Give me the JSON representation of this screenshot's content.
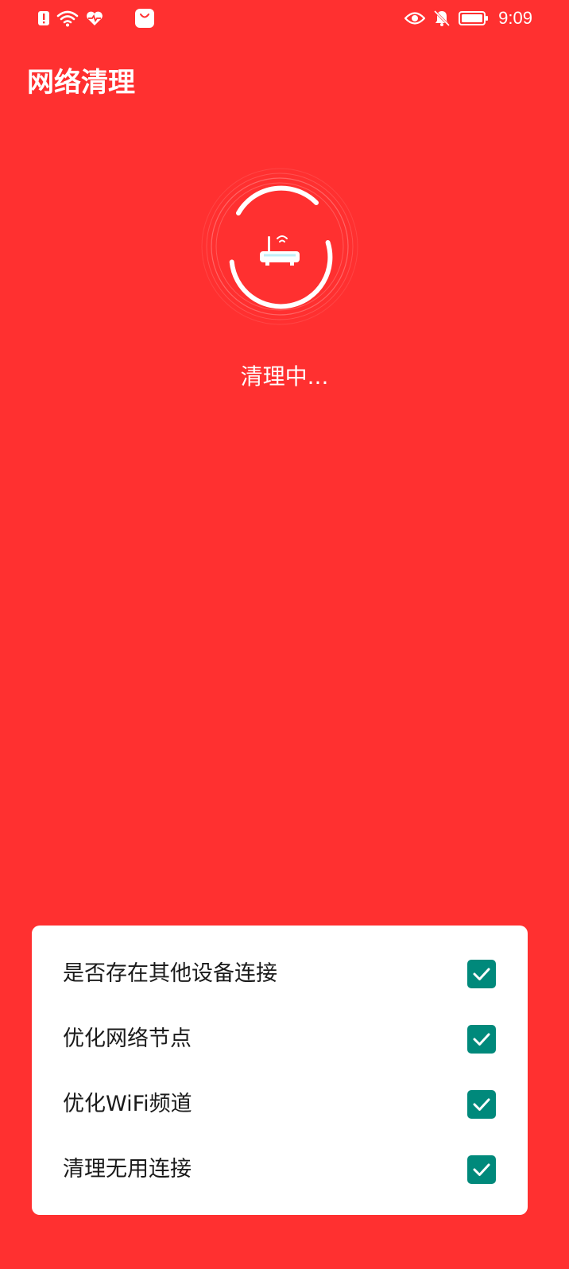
{
  "status_bar": {
    "left_icons": [
      "alert-icon",
      "wifi-icon",
      "heart-health-icon",
      "shopping-bag-icon"
    ],
    "right_icons": [
      "eye-icon",
      "bell-off-icon",
      "battery-icon"
    ],
    "time": "9:09"
  },
  "app_bar": {
    "title": "网络清理"
  },
  "progress": {
    "icon": "router-icon",
    "status_text": "清理中...",
    "accent_color": "#FFFFFF",
    "background_color": "#FF3030"
  },
  "tasks": [
    {
      "label": "是否存在其他设备连接",
      "checked": true
    },
    {
      "label": "优化网络节点",
      "checked": true
    },
    {
      "label": "优化WiFi频道",
      "checked": true
    },
    {
      "label": "清理无用连接",
      "checked": true
    }
  ],
  "checkbox_color": "#00897B"
}
